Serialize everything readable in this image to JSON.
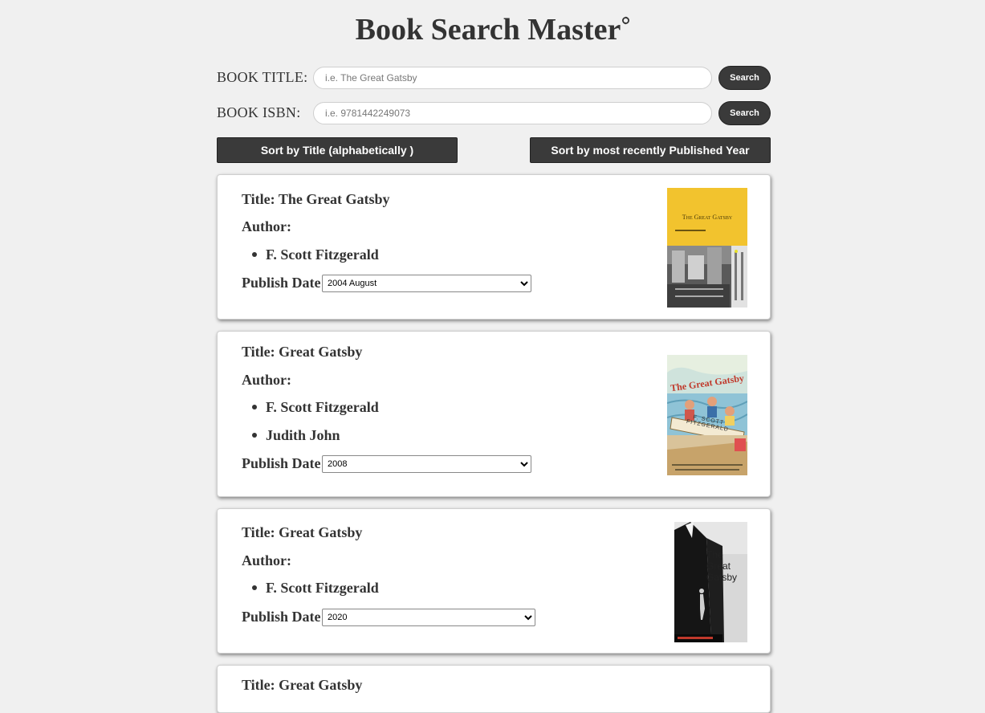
{
  "app": {
    "title": "Book Search Master"
  },
  "search": {
    "title_label": "BOOK TITLE:",
    "title_placeholder": "i.e. The Great Gatsby",
    "title_value": "",
    "title_button": "Search",
    "isbn_label": "BOOK ISBN:",
    "isbn_placeholder": "i.e. 9781442249073",
    "isbn_value": "",
    "isbn_button": "Search"
  },
  "sort": {
    "by_title": "Sort by Title (alphabetically )",
    "by_year": "Sort by most recently Published Year"
  },
  "results": [
    {
      "title_prefix": "Title:",
      "title": "The Great Gatsby",
      "author_label": "Author:",
      "authors": [
        "F. Scott Fitzgerald"
      ],
      "publish_label": "Publish Date:",
      "publish_date": "2004 August",
      "cover_icon": "book-cover-image",
      "cover_title_text": "The Great Gatsby"
    },
    {
      "title_prefix": "Title:",
      "title": "Great Gatsby",
      "author_label": "Author:",
      "authors": [
        "F. Scott Fitzgerald",
        "Judith John"
      ],
      "publish_label": "Publish Date:",
      "publish_date": "2008",
      "cover_icon": "book-cover-image",
      "cover_title_text": "The Great Gatsby",
      "cover_author_text": "F. Scott Fitzgerald"
    },
    {
      "title_prefix": "Title:",
      "title": "Great Gatsby",
      "author_label": "Author:",
      "authors": [
        "F. Scott Fitzgerald"
      ],
      "publish_label": "Publish Date:",
      "publish_date": "2020",
      "cover_icon": "book-cover-image",
      "cover_title_text": "The Great Gatsby"
    },
    {
      "title_prefix": "Title:",
      "title": "Great Gatsby"
    }
  ],
  "colors": {
    "background": "#f0f0f0",
    "button": "#3a3a3a",
    "text": "#333333"
  }
}
